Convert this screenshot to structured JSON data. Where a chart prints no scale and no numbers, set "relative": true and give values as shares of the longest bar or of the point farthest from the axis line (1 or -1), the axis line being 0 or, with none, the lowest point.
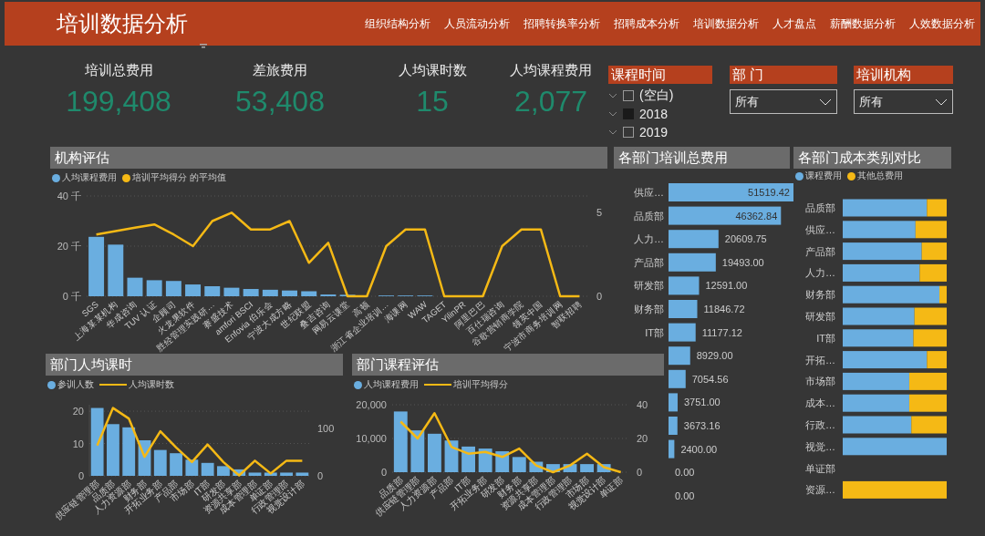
{
  "header": {
    "title": "培训数据分析",
    "nav": [
      "组织结构分析",
      "人员流动分析",
      "招聘转换率分析",
      "招聘成本分析",
      "培训数据分析",
      "人才盘点",
      "薪酬数据分析",
      "人效数据分析"
    ]
  },
  "kpis": [
    {
      "label": "培训总费用",
      "value": "199,408"
    },
    {
      "label": "差旅费用",
      "value": "53,408"
    },
    {
      "label": "人均课时数",
      "value": "15"
    },
    {
      "label": "人均课程费用",
      "value": "2,077"
    }
  ],
  "slicers": [
    {
      "kind": "list",
      "title": "课程时间",
      "items": [
        {
          "label": "(空白)",
          "checked": false
        },
        {
          "label": "2018",
          "checked": true
        },
        {
          "label": "2019",
          "checked": false
        }
      ]
    },
    {
      "kind": "dropdown",
      "title": "部 门",
      "value": "所有"
    },
    {
      "kind": "dropdown",
      "title": "培训机构",
      "value": "所有"
    }
  ],
  "visuals": [
    {
      "kind": "dots",
      "chart_data": {
        "type": "bar",
        "title": "机构评估",
        "categories": [
          "SGS",
          "上海某某机构",
          "华成咨询",
          "TUV 认证",
          "企顾司",
          "火龙果软件",
          "胜经管理实践研…",
          "赛盛技术",
          "amfori BSCI",
          "Enfovia 伯乐会",
          "宁波大成方略",
          "世纪联盟",
          "叠吉咨询",
          "网易云课堂",
          "高顿",
          "浙江省企业培训…",
          "海课网",
          "WAW",
          "TAGET",
          "YilinPR",
          "阿里巴巴",
          "百仕瑞咨询",
          "谷歌营销商学院",
          "领英中国",
          "宁波市商务培训网",
          "智联招聘"
        ],
        "ylim": [
          0,
          40
        ],
        "yticks": [
          {
            "value": 0,
            "label": "0 千"
          },
          {
            "value": 20,
            "label": "20 千"
          },
          {
            "value": 40,
            "label": "40 千"
          }
        ],
        "y2lim": [
          0,
          6
        ],
        "y2ticks": [
          0,
          5
        ],
        "series": [
          {
            "name": "人均课程费用",
            "color": "#6aaee0",
            "type": "bar",
            "values": [
              23.7,
              20.6,
              7.4,
              6.4,
              6.1,
              4.7,
              4.0,
              3.4,
              2.9,
              2.6,
              2.3,
              2.0,
              0.7,
              0.6,
              null,
              0.3,
              0.3,
              0.3,
              0,
              0,
              0,
              0,
              0,
              0,
              0,
              0
            ]
          },
          {
            "name": "培训平均得分 的平均值",
            "color": "#f5b915",
            "type": "line",
            "axis": "y2",
            "values": [
              3.7,
              3.9,
              4.1,
              4.3,
              3.7,
              3.0,
              4.5,
              5,
              4,
              4,
              4.5,
              2,
              3.2,
              0,
              0,
              3,
              4,
              4,
              0,
              0,
              0,
              3,
              4,
              4,
              0,
              0
            ]
          }
        ]
      }
    },
    {
      "chart_data": {
        "type": "bar",
        "orientation": "horizontal",
        "title": "各部门培训总费用",
        "categories": [
          "供应…",
          "品质部",
          "人力…",
          "产品部",
          "研发部",
          "财务部",
          "IT部",
          null,
          null,
          null,
          null,
          null,
          null,
          null
        ],
        "data_labels": true,
        "series": [
          {
            "color": "#6aaee0",
            "values": [
              51519.42,
              46362.84,
              20609.75,
              19493.0,
              12591.0,
              11846.72,
              11177.12,
              8929.0,
              7054.56,
              3751.0,
              3673.16,
              2400.0,
              0.0,
              0.0
            ],
            "value_labels": [
              "51519.42",
              "46362.84",
              "20609.75",
              "19493.00",
              "12591.00",
              "11846.72",
              "11177.12",
              "8929.00",
              "7054.56",
              "3751.00",
              "3673.16",
              "2400.00",
              "0.00",
              "0.00"
            ]
          }
        ]
      }
    },
    {
      "kind": "dots",
      "chart_data": {
        "type": "bar",
        "orientation": "horizontal",
        "stacked": true,
        "relative": true,
        "title": "各部门成本类别对比",
        "categories": [
          "品质部",
          "供应…",
          "产品部",
          "人力…",
          "财务部",
          "研发部",
          "IT部",
          "开拓…",
          "市场部",
          "成本…",
          "行政…",
          "视觉…",
          "单证部",
          "资源…"
        ],
        "series": [
          {
            "name": "课程费用",
            "color": "#6aaee0",
            "values": [
              0.81,
              0.7,
              0.76,
              0.74,
              0.93,
              0.69,
              0.68,
              0.81,
              0.64,
              0.64,
              0.66,
              1,
              null,
              0
            ]
          },
          {
            "name": "其他总费用",
            "color": "#f5b915",
            "values": [
              0.19,
              0.3,
              0.24,
              0.26,
              0.07,
              0.31,
              0.32,
              0.19,
              0.36,
              0.36,
              0.34,
              0,
              null,
              1
            ]
          }
        ]
      }
    },
    {
      "kind": "mixed",
      "chart_data": {
        "type": "bar",
        "title": "部门人均课时",
        "categories": [
          "供应链管理部",
          "品质部",
          "人力资源部",
          "财务部",
          "开拓业务部",
          "产品部",
          "市场部",
          "IT部",
          "研发部",
          "资源共享部",
          "成本管理部",
          "单证部",
          "行政管理部",
          "视觉设计部"
        ],
        "ylim": [
          0,
          22
        ],
        "yticks": [
          0,
          10,
          20
        ],
        "y2lim": [
          0,
          150
        ],
        "y2ticks": [
          0,
          100
        ],
        "series": [
          {
            "name": "参训人数",
            "color": "#6aaee0",
            "type": "bar",
            "values": [
              21,
              16,
              15,
              11,
              8,
              7,
              5,
              4,
              3,
              2,
              1,
              1,
              1,
              1
            ]
          },
          {
            "name": "人均课时数",
            "color": "#f5b915",
            "type": "line",
            "axis": "y2",
            "values": [
              64,
              143,
              121,
              40,
              94,
              60,
              29,
              66,
              29,
              1,
              32,
              5,
              32,
              32
            ]
          }
        ]
      }
    },
    {
      "kind": "mixed",
      "chart_data": {
        "type": "bar",
        "title": "部门课程评估",
        "categories": [
          "品质部",
          "供应链管理部",
          "人力资源部",
          "产品部",
          "IT部",
          "开拓业务部",
          "研发部",
          "财务部",
          "资源共享部",
          "成本管理部",
          "行政管理部",
          "市场部",
          "视觉设计部",
          "单证部"
        ],
        "ylim": [
          0,
          20000
        ],
        "yticks": [
          {
            "value": 0,
            "label": "0"
          },
          {
            "value": 10000,
            "label": "10,000"
          },
          {
            "value": 20000,
            "label": "20,000"
          }
        ],
        "y2lim": [
          0,
          40
        ],
        "y2ticks": [
          0,
          20,
          40
        ],
        "series": [
          {
            "name": "人均课程费用",
            "color": "#6aaee0",
            "type": "bar",
            "values": [
              18000,
              12400,
              11400,
              9400,
              7600,
              7000,
              6200,
              4500,
              3100,
              2400,
              2400,
              2400,
              2400,
              0
            ]
          },
          {
            "name": "培训平均得分",
            "color": "#f5b915",
            "type": "line",
            "axis": "y2",
            "values": [
              30,
              20,
              35,
              15,
              11,
              12,
              9,
              14,
              4,
              0,
              4,
              11,
              3,
              0
            ]
          }
        ]
      }
    }
  ]
}
